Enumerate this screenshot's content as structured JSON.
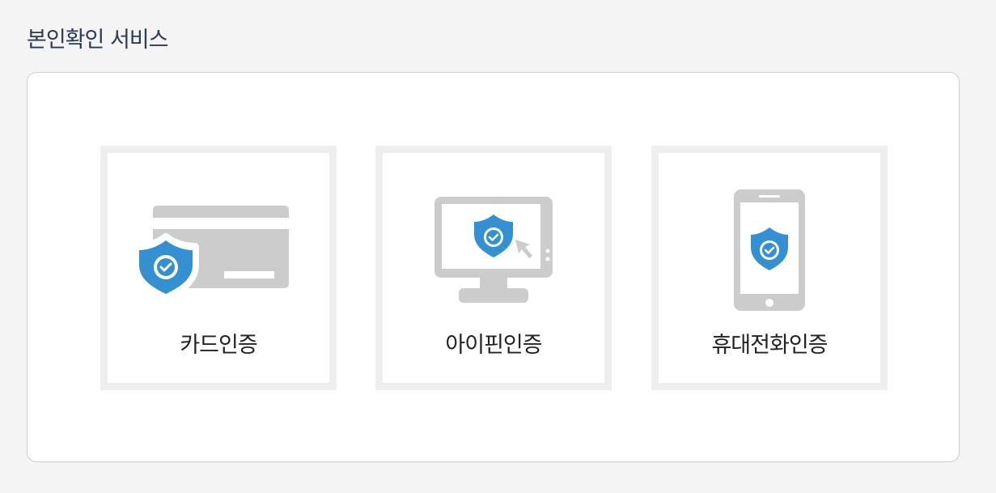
{
  "page": {
    "title": "본인확인 서비스"
  },
  "options": [
    {
      "id": "card",
      "label": "카드인증",
      "icon": "card-shield-icon"
    },
    {
      "id": "ipin",
      "label": "아이핀인증",
      "icon": "monitor-shield-icon"
    },
    {
      "id": "phone",
      "label": "휴대전화인증",
      "icon": "phone-shield-icon"
    }
  ],
  "colors": {
    "background": "#f4f4f4",
    "title": "#2b3a55",
    "icon_gray": "#cccccc",
    "shield_blue": "#3490d0",
    "tile_border": "#eeeeee"
  }
}
